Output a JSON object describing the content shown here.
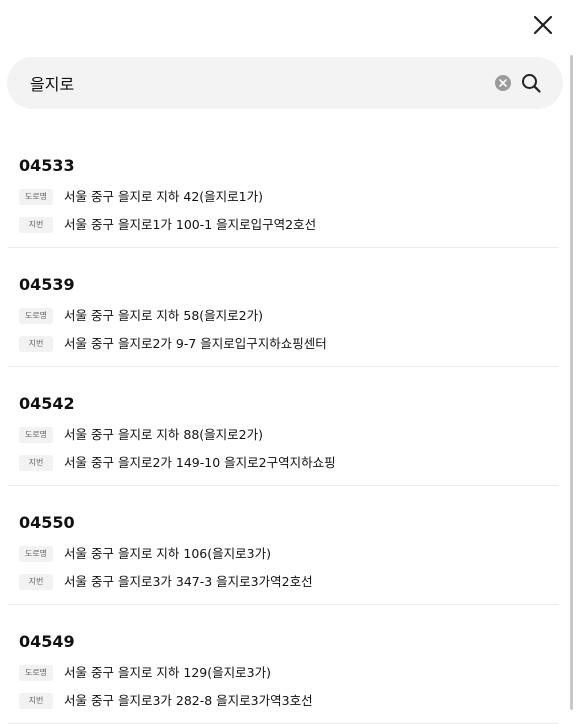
{
  "search": {
    "value": "을지로",
    "placeholder": ""
  },
  "icons": {
    "close": "close-icon",
    "clear": "clear-circle-icon",
    "search": "search-icon"
  },
  "colors": {
    "search_bg": "#f3f3f3",
    "badge_bg": "#f2f2f2",
    "badge_text": "#666666",
    "divider": "#ececec",
    "text": "#111111"
  },
  "results": [
    {
      "zipcode": "04533",
      "road_badge": "도로명",
      "road_address": "서울 중구 을지로 지하 42(을지로1가)",
      "lot_badge": "지번",
      "lot_address": "서울 중구 을지로1가 100-1 을지로입구역2호선"
    },
    {
      "zipcode": "04539",
      "road_badge": "도로명",
      "road_address": "서울 중구 을지로 지하 58(을지로2가)",
      "lot_badge": "지번",
      "lot_address": "서울 중구 을지로2가 9-7 을지로입구지하쇼핑센터"
    },
    {
      "zipcode": "04542",
      "road_badge": "도로명",
      "road_address": "서울 중구 을지로 지하 88(을지로2가)",
      "lot_badge": "지번",
      "lot_address": "서울 중구 을지로2가 149-10 을지로2구역지하쇼핑"
    },
    {
      "zipcode": "04550",
      "road_badge": "도로명",
      "road_address": "서울 중구 을지로 지하 106(을지로3가)",
      "lot_badge": "지번",
      "lot_address": "서울 중구 을지로3가 347-3 을지로3가역2호선"
    },
    {
      "zipcode": "04549",
      "road_badge": "도로명",
      "road_address": "서울 중구 을지로 지하 129(을지로3가)",
      "lot_badge": "지번",
      "lot_address": "서울 중구 을지로3가 282-8 을지로3가역3호선"
    }
  ]
}
